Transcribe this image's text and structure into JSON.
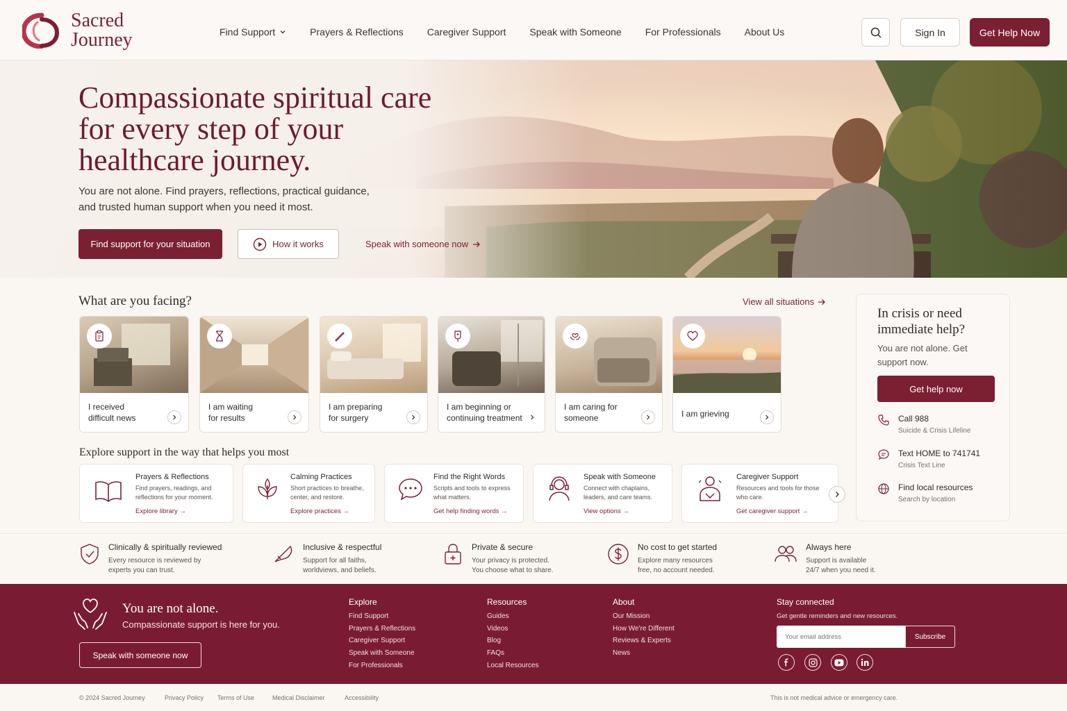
{
  "brand": {
    "line1": "Sacred",
    "line2": "Journey",
    "accent": "#7b1f33"
  },
  "nav": {
    "items": [
      {
        "label": "Find Support",
        "has_dropdown": true
      },
      {
        "label": "Prayers & Reflections"
      },
      {
        "label": "Caregiver Support"
      },
      {
        "label": "Speak with Someone"
      },
      {
        "label": "For Professionals"
      },
      {
        "label": "About Us"
      }
    ],
    "search_icon": "search-icon",
    "sign_in": "Sign In",
    "get_help": "Get Help Now"
  },
  "hero": {
    "title_line1": "Compassionate spiritual care",
    "title_line2": "for every step of your",
    "title_line3": "healthcare journey.",
    "subtitle_line1": "You are not alone. Find prayers, reflections, practical guidance,",
    "subtitle_line2": "and trusted human support when you need it most.",
    "primary_cta": "Find support for your situation",
    "secondary_cta": "How it works",
    "link_cta": "Speak with someone now"
  },
  "facing": {
    "title": "What are you facing?",
    "view_all": "View all situations",
    "cards": [
      {
        "line1": "I received",
        "line2": "difficult news",
        "icon": "clipboard-icon"
      },
      {
        "line1": "I am waiting",
        "line2": "for results",
        "icon": "hourglass-icon"
      },
      {
        "line1": "I am preparing",
        "line2": "for surgery",
        "icon": "scalpel-icon"
      },
      {
        "line1": "I am beginning or",
        "line2": "continuing treatment",
        "icon": "iv-bag-icon"
      },
      {
        "line1": "I am caring for",
        "line2": "someone",
        "icon": "hands-heart-icon"
      },
      {
        "line1": "I am grieving",
        "line2": "",
        "icon": "heart-icon"
      }
    ]
  },
  "crisis": {
    "title": "In crisis or need immediate help?",
    "subtitle": "You are not alone. Get support now.",
    "button": "Get help now",
    "rows": [
      {
        "title": "Call 988",
        "sub": "Suicide & Crisis Lifeline",
        "icon": "phone-icon"
      },
      {
        "title": "Text HOME to 741741",
        "sub": "Crisis Text Line",
        "icon": "chat-icon"
      },
      {
        "title": "Find local resources",
        "sub": "Search by location",
        "icon": "globe-icon"
      }
    ]
  },
  "explore": {
    "title": "Explore support in the way that helps you most",
    "cards": [
      {
        "title": "Prayers & Reflections",
        "desc": "Find prayers, readings, and reflections for your moment.",
        "link": "Explore library",
        "icon": "book-icon"
      },
      {
        "title": "Calming Practices",
        "desc": "Short practices to breathe, center, and restore.",
        "link": "Explore practices",
        "icon": "leaf-icon"
      },
      {
        "title": "Find the Right Words",
        "desc": "Scripts and tools to express what matters.",
        "link": "Get help finding words",
        "icon": "speech-bubble-icon"
      },
      {
        "title": "Speak with Someone",
        "desc": "Connect with chaplains, leaders, and care teams.",
        "link": "View options",
        "icon": "headset-icon"
      },
      {
        "title": "Caregiver Support",
        "desc": "Resources and tools for those who care.",
        "link": "Get caregiver support",
        "icon": "caregiver-icon"
      }
    ]
  },
  "trust": [
    {
      "title": "Clinically & spiritually reviewed",
      "line1": "Every resource is reviewed by",
      "line2": "experts you can trust.",
      "icon": "shield-check-icon"
    },
    {
      "title": "Inclusive & respectful",
      "line1": "Support for all faiths,",
      "line2": "worldviews, and beliefs.",
      "icon": "feather-icon"
    },
    {
      "title": "Private & secure",
      "line1": "Your privacy is protected.",
      "line2": "You choose what to share.",
      "icon": "lock-icon"
    },
    {
      "title": "No cost to get started",
      "line1": "Explore many resources",
      "line2": "free, no account needed.",
      "icon": "dollar-icon"
    },
    {
      "title": "Always here",
      "line1": "Support is available",
      "line2": "24/7 when you need it.",
      "icon": "people-icon"
    }
  ],
  "footer": {
    "heading": "You are not alone.",
    "sub": "Compassionate support is here for you.",
    "cta": "Speak with someone now",
    "cols": [
      {
        "title": "Explore",
        "items": [
          "Find Support",
          "Prayers & Reflections",
          "Caregiver Support",
          "Speak with Someone",
          "For Professionals"
        ]
      },
      {
        "title": "Resources",
        "items": [
          "Guides",
          "Videos",
          "Blog",
          "FAQs",
          "Local Resources"
        ]
      },
      {
        "title": "About",
        "items": [
          "Our Mission",
          "How We're Different",
          "Reviews & Experts",
          "News"
        ]
      }
    ],
    "stay": {
      "title": "Stay connected",
      "sub": "Get gentle reminders and new resources.",
      "placeholder": "Your email address",
      "button": "Subscribe"
    },
    "social": [
      "facebook-icon",
      "instagram-icon",
      "youtube-icon",
      "linkedin-icon"
    ]
  },
  "bottom": {
    "copyright": "© 2024 Sacred Journey",
    "links": [
      "Privacy Policy",
      "Terms of Use",
      "Medical Disclaimer",
      "Accessibility"
    ],
    "disclaimer": "This is not medical advice or emergency care."
  }
}
